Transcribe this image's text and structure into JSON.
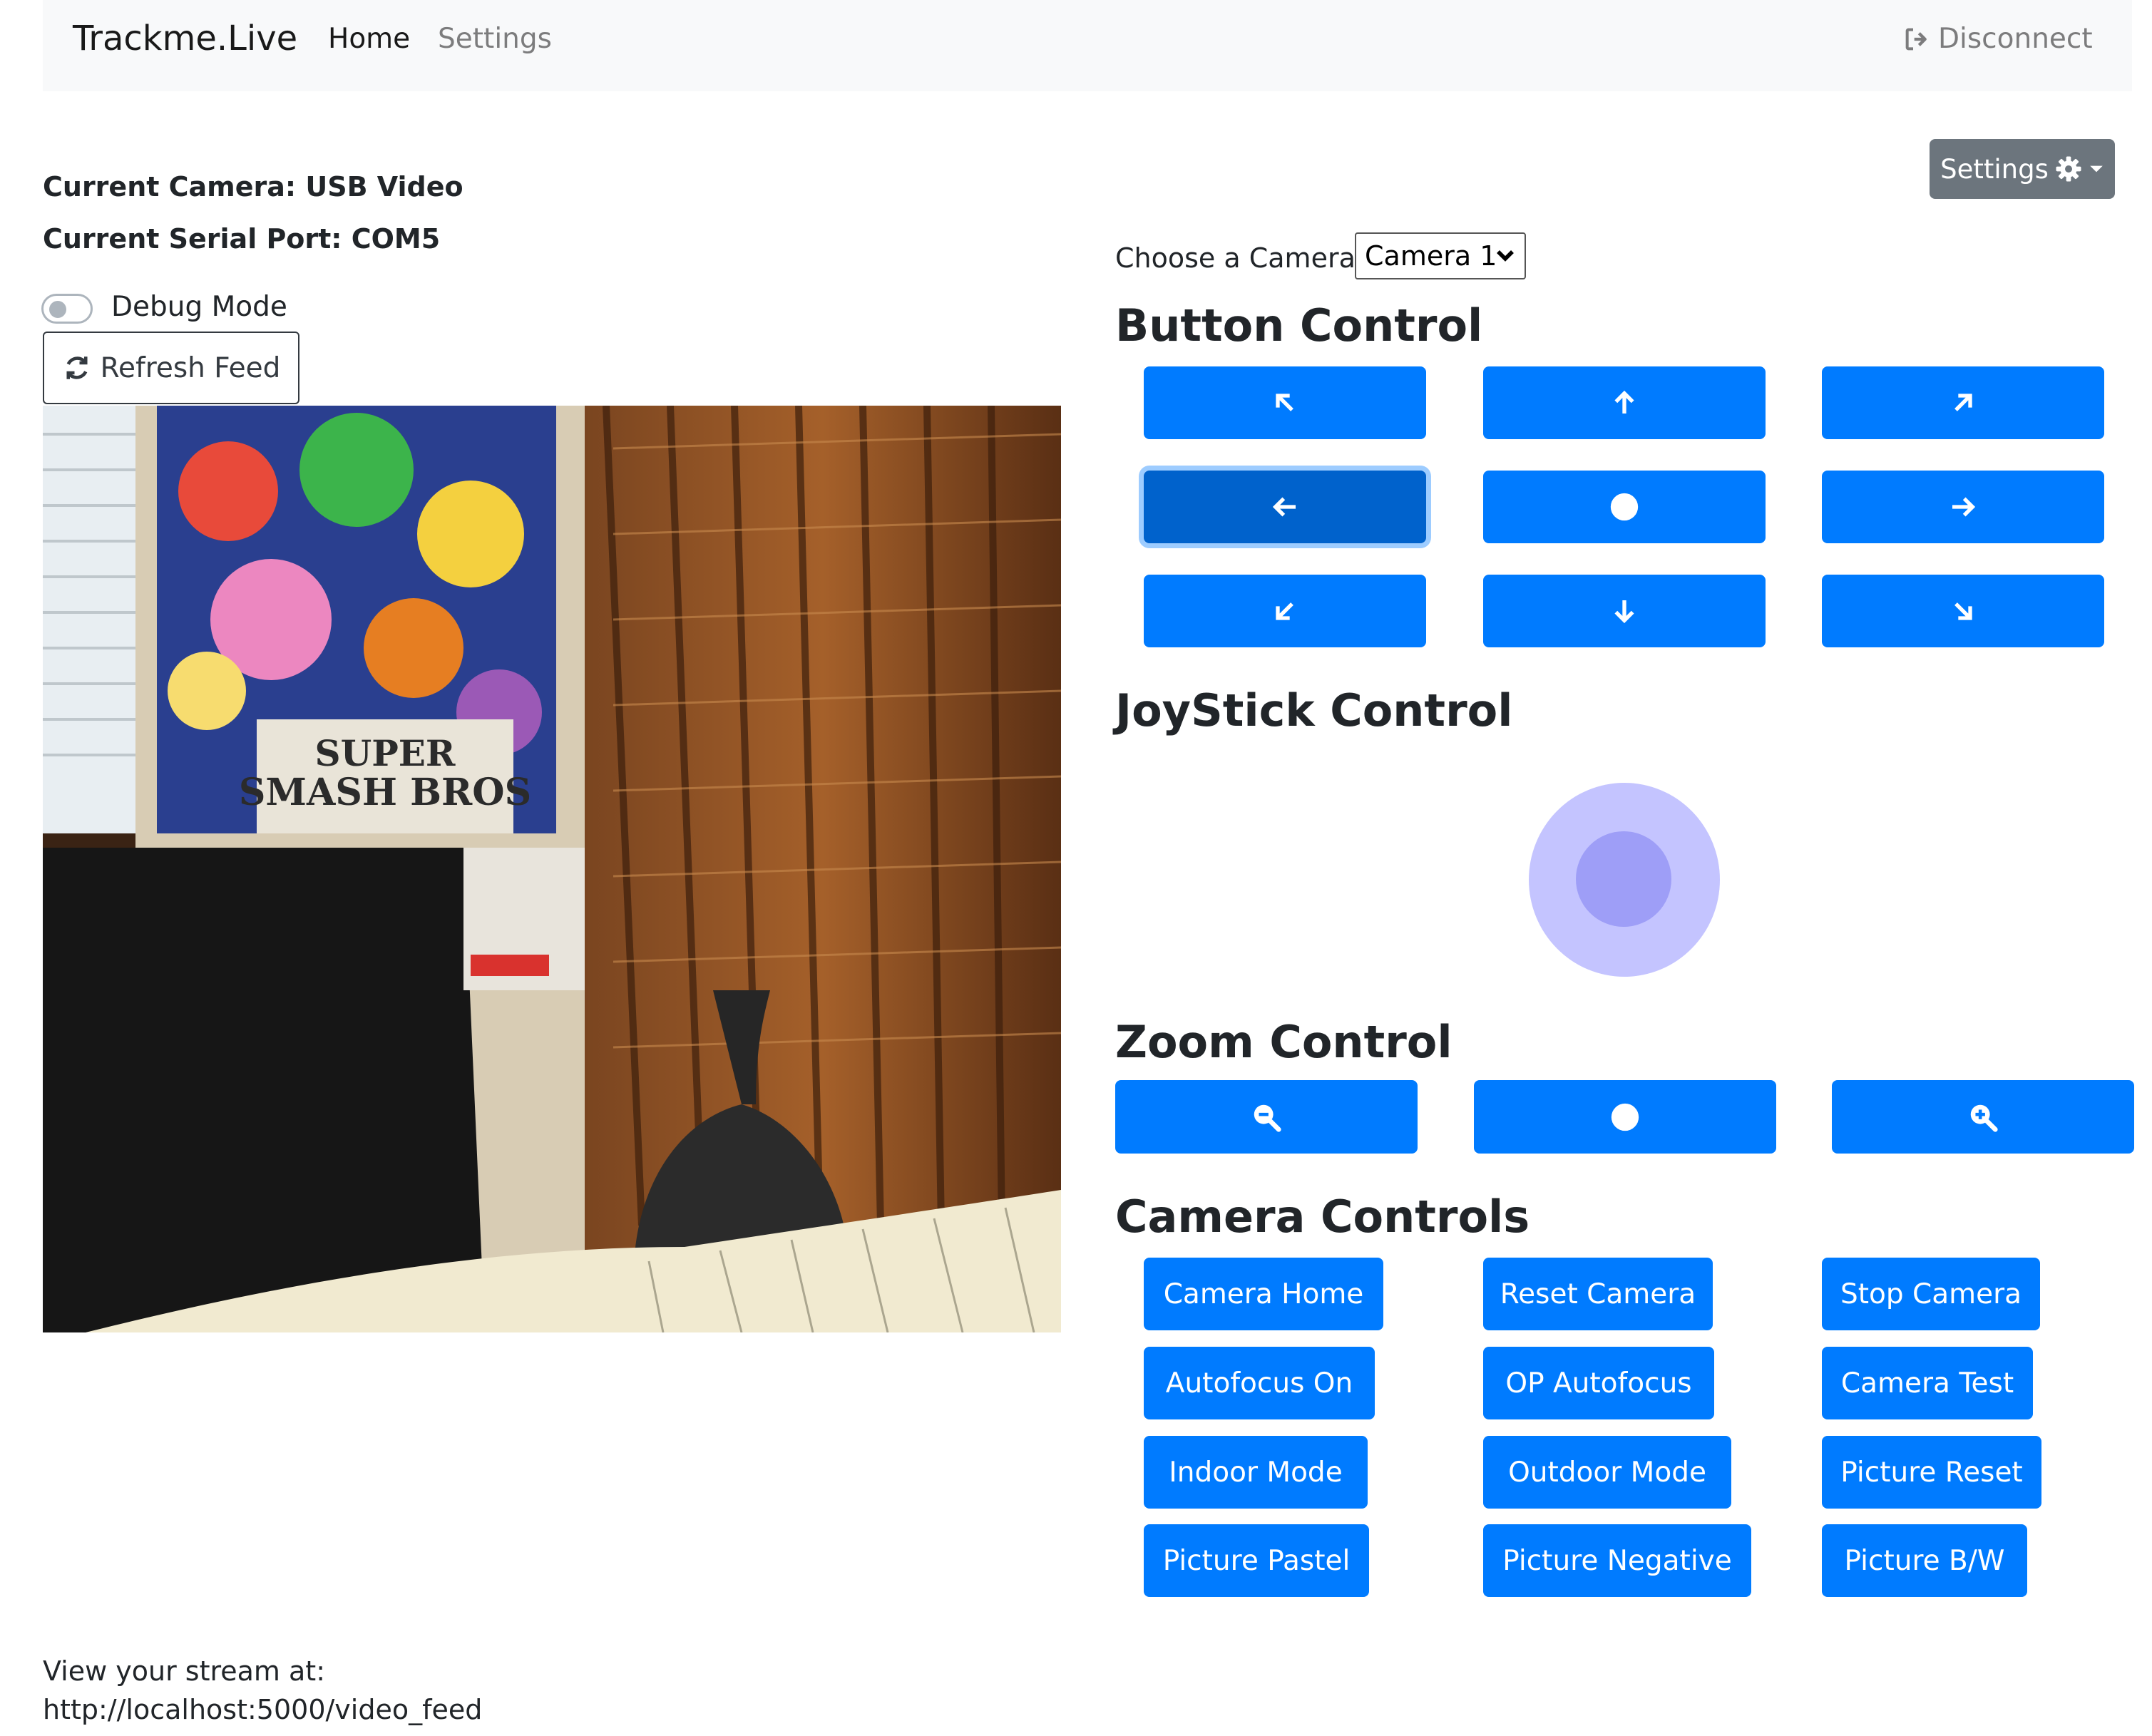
{
  "navbar": {
    "brand": "Trackme.Live",
    "links": [
      "Home",
      "Settings"
    ],
    "disconnect_label": "Disconnect",
    "disconnect_icon": "sign-out-icon"
  },
  "status": {
    "current_camera": "Current Camera: USB Video",
    "current_serial_port": "Current Serial Port: COM5"
  },
  "debug_mode": {
    "label": "Debug Mode",
    "enabled": false
  },
  "refresh_button": {
    "label": "Refresh Feed",
    "icon": "refresh-icon"
  },
  "video_feed": {
    "alt": "camera feed"
  },
  "stream": {
    "label": "View your stream at:",
    "url": "http://localhost:5000/video_feed"
  },
  "settings_dropdown": {
    "label": "Settings",
    "icon": "gear-icon"
  },
  "camera_chooser": {
    "label": "Choose a Camera:",
    "selected": "Camera 1"
  },
  "sections": {
    "button_control": "Button Control",
    "joystick_control": "JoyStick Control",
    "zoom_control": "Zoom Control",
    "camera_controls": "Camera Controls"
  },
  "direction_buttons": [
    "arrow-up-left-icon",
    "arrow-up-icon",
    "arrow-up-right-icon",
    "arrow-left-icon",
    "circle-stop-icon",
    "arrow-right-icon",
    "arrow-down-left-icon",
    "arrow-down-icon",
    "arrow-down-right-icon"
  ],
  "zoom_buttons": [
    "zoom-out-icon",
    "circle-stop-icon",
    "zoom-in-icon"
  ],
  "camera_controls": {
    "camera_home": "Camera Home",
    "reset_camera": "Reset Camera",
    "stop_camera": "Stop Camera",
    "autofocus_on": "Autofocus On",
    "op_autofocus": "OP Autofocus",
    "camera_test": "Camera Test",
    "indoor_mode": "Indoor Mode",
    "outdoor_mode": "Outdoor Mode",
    "picture_reset": "Picture Reset",
    "picture_pastel": "Picture Pastel",
    "picture_negative": "Picture Negative",
    "picture_bw": "Picture B/W"
  },
  "colors": {
    "primary": "#007bff",
    "primary_focus": "#0062cc",
    "secondary": "#6c757d",
    "navbar_bg": "#f8f9fa",
    "joystick_outer": "#c4c4ff",
    "joystick_inner": "#9e9ef7"
  }
}
